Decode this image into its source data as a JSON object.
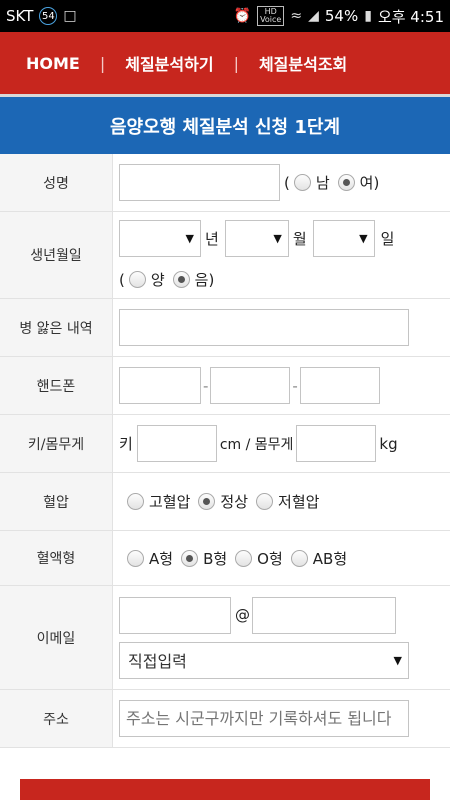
{
  "status_bar": {
    "carrier": "SKT",
    "badge": "54",
    "hd_voice_top": "HD",
    "hd_voice_bottom": "Voice",
    "battery": "54%",
    "time": "오후 4:51"
  },
  "nav": {
    "items": [
      "HOME",
      "체질분석하기",
      "체질분석조회"
    ],
    "separator": "|"
  },
  "title": "음양오행 체질분석 신청 1단계",
  "form": {
    "name_label": "성명",
    "gender": {
      "open": "(",
      "male": "남",
      "female": "여",
      "close": ")",
      "selected": "female"
    },
    "birth_label": "생년월일",
    "birth": {
      "year_unit": "년",
      "month_unit": "월",
      "day_unit": "일",
      "open": "(",
      "solar": "양",
      "lunar": "음",
      "close": ")",
      "selected": "lunar"
    },
    "illness_label": "병 앓은 내역",
    "phone_label": "핸드폰",
    "phone_dash": "-",
    "height_weight_label": "키/몸무게",
    "height_prefix": "키",
    "height_unit": "cm / 몸무게",
    "weight_unit": "kg",
    "bp_label": "혈압",
    "bp": {
      "options": [
        "고혈압",
        "정상",
        "저혈압"
      ],
      "selected": "정상"
    },
    "blood_label": "혈액형",
    "blood": {
      "options": [
        "A형",
        "B형",
        "O형",
        "AB형"
      ],
      "selected": "B형"
    },
    "email_label": "이메일",
    "email_at": "@",
    "email_domain_select": "직접입력",
    "address_label": "주소",
    "address_placeholder": "주소는 시군구까지만 기록하셔도 됩니다"
  },
  "colors": {
    "nav": "#c7261e",
    "title": "#1c67b5"
  }
}
